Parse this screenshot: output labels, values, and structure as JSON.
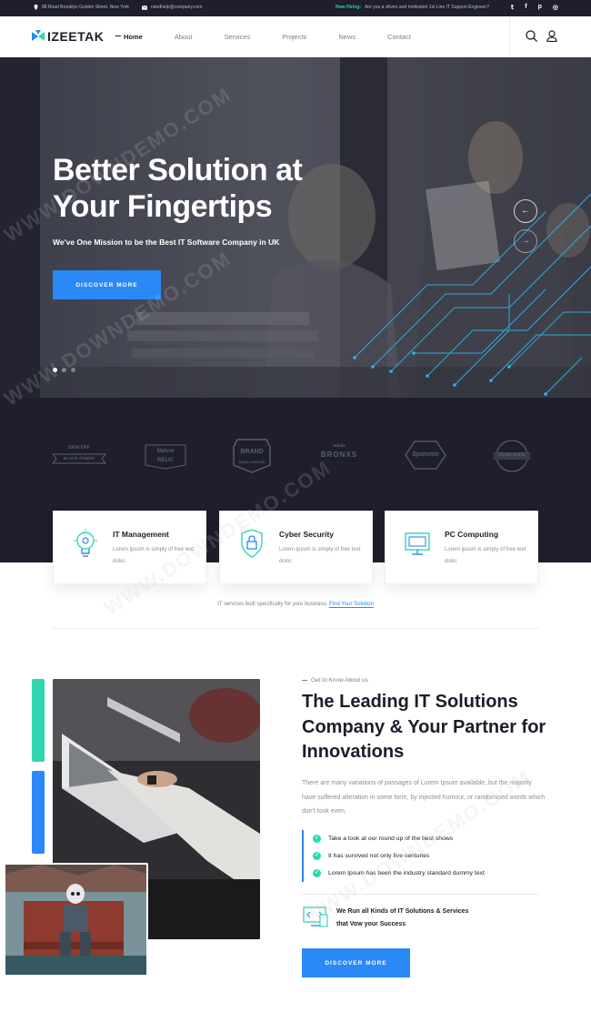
{
  "topbar": {
    "address": "88 Road Brooklyn Golden Street. New York",
    "email": "needhelp@company.com",
    "hiring_label": "Now Hiring:",
    "hiring_text": "Are you a driven and motivated 1st Line IT Support Engineer?",
    "socials": [
      "twitter-icon",
      "facebook-icon",
      "pinterest-icon",
      "instagram-icon"
    ]
  },
  "header": {
    "logo_text": "IZEETAK",
    "nav": [
      "Home",
      "About",
      "Services",
      "Projects",
      "News",
      "Contact"
    ],
    "active_nav": "Home"
  },
  "hero": {
    "title_line1": "Better Solution at",
    "title_line2": "Your Fingertips",
    "subtitle": "We've One Mission to be the Best IT Software Company in UK",
    "button": "DISCOVER MORE",
    "slides": 3,
    "active_slide": 1
  },
  "brands": [
    {
      "line1": "SIGN OFF",
      "line2": "BLACK STUDIO"
    },
    {
      "line1": "Nature",
      "line2": "RELIC"
    },
    {
      "line1": "BRAND",
      "line2": "SMALL HOUSE"
    },
    {
      "line1": "BRONXS",
      "line2": "Studio"
    },
    {
      "line1": "Sparonic",
      "line2": ""
    },
    {
      "line1": "EDGE SAFE",
      "line2": ""
    }
  ],
  "services": [
    {
      "title": "IT Management",
      "text": "Lorem ipsum is simply of free text dolor.",
      "icon": "bulb-gear-icon"
    },
    {
      "title": "Cyber Security",
      "text": "Lorem ipsum is simply of free text dolor.",
      "icon": "shield-lock-icon"
    },
    {
      "title": "PC Computing",
      "text": "Lorem ipsum is simply of free text dolor.",
      "icon": "monitor-icon"
    }
  ],
  "tagline": {
    "text": "IT services built specifically for your business.",
    "link": "Find Your Solution"
  },
  "about": {
    "eyebrow": "Get to Know About us",
    "title": "The Leading IT Solutions Company & Your Partner for Innovations",
    "paragraph": "There are many variations of passages of Lorem Ipsum available, but the majority have suffered alteration in some form, by injected humour, or randomised words which don't look even.",
    "checks": [
      "Take a look at our round up of the best shows",
      "It has survived not only five centuries",
      "Lorem Ipsum has been the industry standard dummy text"
    ],
    "solve_line1": "We Run all Kinds of IT Solutions & Services",
    "solve_line2": "that Vow your Success",
    "button": "DISCOVER MORE"
  },
  "colors": {
    "accent_blue": "#2b88f7",
    "accent_green": "#30d6b0",
    "dark": "#1e1e2c"
  },
  "watermark": "WWW.DOWNDEMO.COM"
}
